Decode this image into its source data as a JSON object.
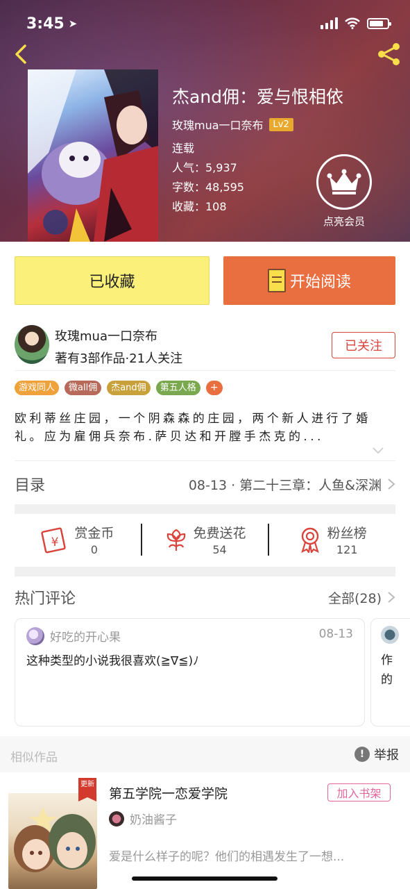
{
  "status_bar": {
    "time": "3:45"
  },
  "header": {
    "book_title": "杰and佣：爱与恨相依",
    "author": "玫瑰mua一口奈布",
    "level": "Lv2",
    "status": "连载",
    "popularity": "人气：5,937",
    "word_count": "字数：48,595",
    "favorites": "收藏：108",
    "vip_label": "点亮会员"
  },
  "actions": {
    "favorited_label": "已收藏",
    "read_label": "开始阅读"
  },
  "author_section": {
    "name": "玫瑰mua一口奈布",
    "stats": "著有3部作品·21人关注",
    "follow_label": "已关注"
  },
  "tags": [
    {
      "label": "游戏同人",
      "color": "#f0a23a"
    },
    {
      "label": "微all佣",
      "color": "#b86a5a"
    },
    {
      "label": "杰and佣",
      "color": "#c9a13a"
    },
    {
      "label": "第五人格",
      "color": "#7aa84e"
    }
  ],
  "tag_more": "+",
  "description": "欧利蒂丝庄园，一个阴森森的庄园，两个新人进行了婚礼。应为雇佣兵奈布.萨贝达和开膛手杰克的...",
  "catalog": {
    "title": "目录",
    "latest": "08-13 · 第二十三章：人鱼&深渊"
  },
  "stats": [
    {
      "label": "赏金币",
      "value": "0",
      "icon": "red-envelope-icon"
    },
    {
      "label": "免费送花",
      "value": "54",
      "icon": "flower-icon"
    },
    {
      "label": "粉丝榜",
      "value": "121",
      "icon": "medal-icon"
    }
  ],
  "comments": {
    "title": "热门评论",
    "all_label": "全部(28)",
    "items": [
      {
        "user": "好吃的开心果",
        "date": "08-13",
        "text": "这种类型的小说我很喜欢(≧∇≦)ﾉ"
      },
      {
        "text": "作的"
      }
    ]
  },
  "similar": {
    "title": "相似作品",
    "report_label": "举报",
    "items": [
      {
        "badge": "更新",
        "title": "第五学院一恋爱学院",
        "author": "奶油酱子",
        "shelf_label": "加入书架",
        "desc": "爱是什么样子的呢？他们的相遇发生了一想..."
      }
    ]
  },
  "colors": {
    "accent_orange": "#e96e40",
    "favorite_yellow": "#fbf17a",
    "follow_red": "#d9453d",
    "shelf_pink": "#e0669c"
  }
}
